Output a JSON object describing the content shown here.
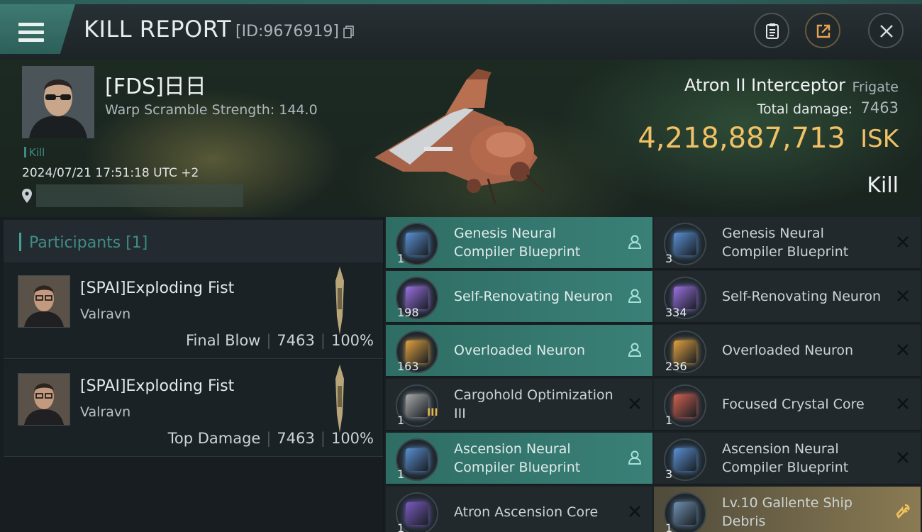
{
  "header": {
    "title": "KILL REPORT",
    "report_id": "[ID:9676919]"
  },
  "victim": {
    "name": "[FDS]日日",
    "warp_scramble": "Warp Scramble Strength: 144.0",
    "kill_tag": "Kill",
    "timestamp": "2024/07/21 17:51:18 UTC +2",
    "ship_name": "Atron II Interceptor",
    "ship_class": "Frigate",
    "damage_label": "Total damage:",
    "damage_value": "7463",
    "isk_value": "4,218,887,713",
    "isk_unit": "ISK",
    "result": "Kill"
  },
  "participants": {
    "title": "Participants [1]",
    "rows": [
      {
        "name": "[SPAI]Exploding Fist",
        "ship": "Valravn",
        "role": "Final Blow",
        "damage": "7463",
        "percent": "100%"
      },
      {
        "name": "[SPAI]Exploding Fist",
        "ship": "Valravn",
        "role": "Top Damage",
        "damage": "7463",
        "percent": "100%"
      }
    ]
  },
  "items": [
    {
      "name": "Genesis Neural Compiler Blueprint",
      "qty": "1",
      "state": "dropped",
      "icon": "blueprint-icon",
      "color": "#5a8fd1"
    },
    {
      "name": "Genesis Neural Compiler Blueprint",
      "qty": "3",
      "state": "destroyed",
      "icon": "blueprint-icon",
      "color": "#5a8fd1"
    },
    {
      "name": "Self-Renovating Neuron",
      "qty": "198",
      "state": "dropped",
      "icon": "neuron-icon",
      "color": "#9a6fe0"
    },
    {
      "name": "Self-Renovating Neuron",
      "qty": "334",
      "state": "destroyed",
      "icon": "neuron-icon",
      "color": "#9a6fe0"
    },
    {
      "name": "Overloaded Neuron",
      "qty": "163",
      "state": "dropped",
      "icon": "neuron-icon",
      "color": "#e0a040"
    },
    {
      "name": "Overloaded Neuron",
      "qty": "236",
      "state": "destroyed",
      "icon": "neuron-icon",
      "color": "#e0a040"
    },
    {
      "name": "Cargohold Optimization III",
      "qty": "1",
      "state": "destroyed",
      "icon": "module-icon",
      "color": "#a8a8a8",
      "badge": "III"
    },
    {
      "name": "Focused Crystal Core",
      "qty": "1",
      "state": "destroyed",
      "icon": "core-icon",
      "color": "#d06050"
    },
    {
      "name": "Ascension Neural Compiler Blueprint",
      "qty": "1",
      "state": "dropped",
      "icon": "blueprint-icon",
      "color": "#5a8fd1"
    },
    {
      "name": "Ascension Neural Compiler Blueprint",
      "qty": "3",
      "state": "destroyed",
      "icon": "blueprint-icon",
      "color": "#5a8fd1"
    },
    {
      "name": "Atron Ascension Core",
      "qty": "1",
      "state": "destroyed",
      "icon": "core-icon",
      "color": "#7a5ac0"
    },
    {
      "name": "Lv.10 Gallente Ship Debris",
      "qty": "1",
      "state": "salvage",
      "icon": "debris-icon",
      "color": "#6f8fb0"
    }
  ]
}
